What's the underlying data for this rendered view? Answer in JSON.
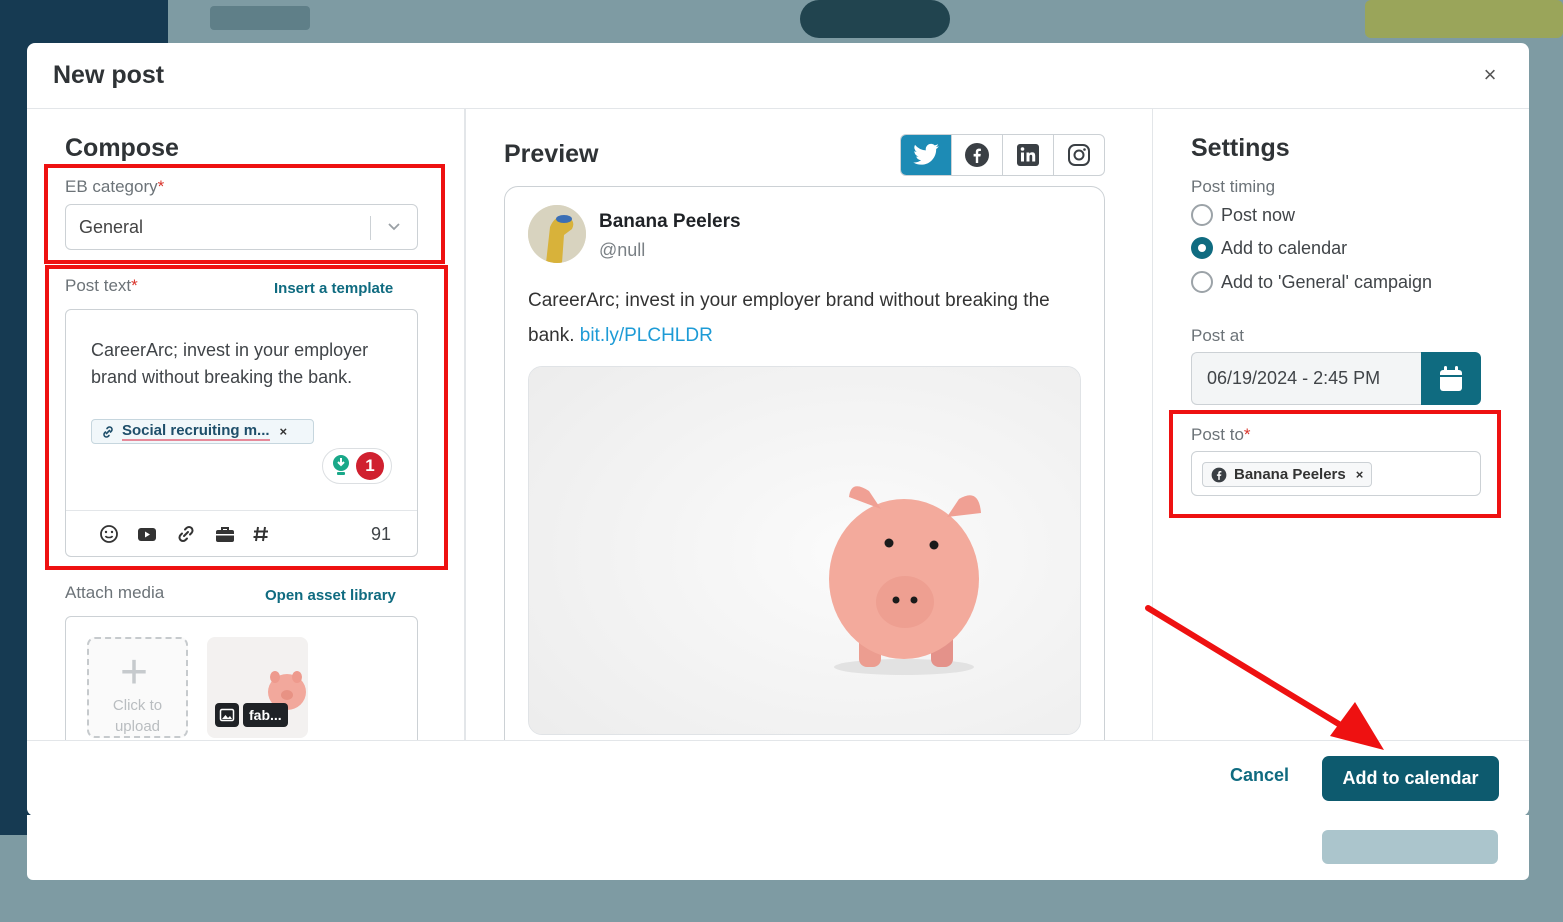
{
  "modal": {
    "title": "New post",
    "close_label": "×"
  },
  "compose": {
    "title": "Compose",
    "category_label": "EB category",
    "category_value": "General",
    "required_mark": "*",
    "post_text_label": "Post text",
    "insert_template_label": "Insert a template",
    "post_text": "CareerArc; invest in your employer brand without breaking the bank.",
    "link_chip_label": "Social recruiting m...",
    "chip_remove": "×",
    "issue_count": "1",
    "char_count": "91",
    "attach_media_label": "Attach media",
    "open_asset_library_label": "Open asset library",
    "upload_label": "Click to upload",
    "thumb_name": "fab..."
  },
  "preview": {
    "title": "Preview",
    "networks": [
      "twitter",
      "facebook",
      "linkedin",
      "instagram"
    ],
    "active_network": "twitter",
    "account_name": "Banana Peelers",
    "account_handle": "@null",
    "tweet_text": "CareerArc; invest in your employer brand without breaking the bank.",
    "tweet_link": "bit.ly/PLCHLDR"
  },
  "settings": {
    "title": "Settings",
    "post_timing_label": "Post timing",
    "options": [
      "Post now",
      "Add to calendar",
      "Add to 'General' campaign"
    ],
    "selected_option": "Add to calendar",
    "post_at_label": "Post at",
    "post_at_value": "06/19/2024 - 2:45 PM",
    "post_to_label": "Post to",
    "post_to_account": "Banana Peelers",
    "chip_remove": "×"
  },
  "footer": {
    "cancel_label": "Cancel",
    "primary_label": "Add to calendar"
  },
  "colors": {
    "primary": "#0d5a6e",
    "accent": "#0f6b80",
    "twitter": "#1d8bb5",
    "highlight": "#ee1111",
    "required": "#d9342b"
  }
}
